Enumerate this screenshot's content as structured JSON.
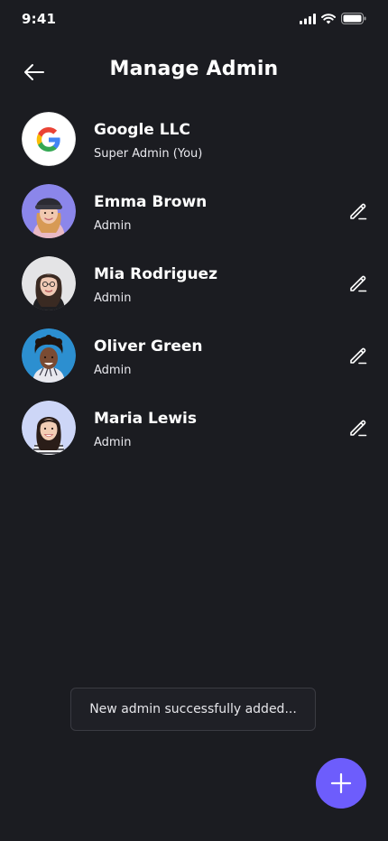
{
  "status_bar": {
    "time": "9:41"
  },
  "header": {
    "title": "Manage Admin"
  },
  "admins": [
    {
      "name": "Google LLC",
      "role": "Super Admin (You)",
      "avatar": "google-logo",
      "editable": false
    },
    {
      "name": "Emma Brown",
      "role": "Admin",
      "avatar": "emma-brown",
      "editable": true
    },
    {
      "name": "Mia Rodriguez",
      "role": "Admin",
      "avatar": "mia-rodriguez",
      "editable": true
    },
    {
      "name": "Oliver Green",
      "role": "Admin",
      "avatar": "oliver-green",
      "editable": true
    },
    {
      "name": "Maria Lewis",
      "role": "Admin",
      "avatar": "maria-lewis",
      "editable": true
    }
  ],
  "toast": {
    "message": "New admin successfully added..."
  },
  "fab": {
    "icon": "plus-icon"
  },
  "colors": {
    "background": "#1b1c21",
    "accent": "#6d5dfc",
    "toast_bg": "#1f2026"
  },
  "icons": {
    "back": "arrow-left-icon",
    "edit": "pencil-icon",
    "signal": "signal-icon",
    "wifi": "wifi-icon",
    "battery": "battery-icon"
  }
}
